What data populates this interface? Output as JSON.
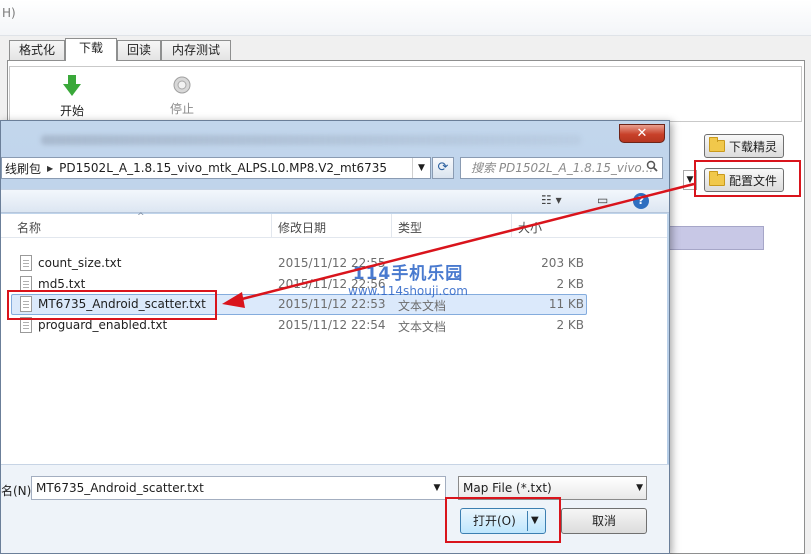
{
  "window": {
    "title_fragment": "H)"
  },
  "tabs": [
    {
      "label": "格式化"
    },
    {
      "label": "下载",
      "active": true
    },
    {
      "label": "回读"
    },
    {
      "label": "内存测试"
    }
  ],
  "toolbar": {
    "start_label": "开始",
    "stop_label": "停止"
  },
  "side_buttons": {
    "download_agent": "下载精灵",
    "config_file": "配置文件"
  },
  "dialog": {
    "close_glyph": "✕",
    "address": {
      "parent": "线刷包",
      "current": "PD1502L_A_1.8.15_vivo_mtk_ALPS.L0.MP8.V2_mt6735"
    },
    "search_placeholder": "搜索 PD1502L_A_1.8.15_vivo...",
    "columns": {
      "name": "名称",
      "date": "修改日期",
      "type": "类型",
      "size": "大小"
    },
    "files": [
      {
        "name": "count_size.txt",
        "date": "2015/11/12 22:55",
        "type": "",
        "size": "203 KB"
      },
      {
        "name": "md5.txt",
        "date": "2015/11/12 22:56",
        "type": "",
        "size": "2 KB"
      },
      {
        "name": "MT6735_Android_scatter.txt",
        "date": "2015/11/12 22:53",
        "type": "文本文档",
        "size": "11 KB",
        "selected": true
      },
      {
        "name": "proguard_enabled.txt",
        "date": "2015/11/12 22:54",
        "type": "文本文档",
        "size": "2 KB"
      }
    ],
    "filename_label": "名(N):",
    "filename_value": "MT6735_Android_scatter.txt",
    "filetype_value": "Map File (*.txt)",
    "open_label": "打开(O)",
    "cancel_label": "取消"
  },
  "watermark": {
    "line1": "114手机乐园",
    "line2": "www.114shouji.com"
  },
  "colors": {
    "annotation_red": "#d9141c",
    "selection_bg": "#dbe9fb",
    "dialog_frame": "#b3cbe6"
  }
}
